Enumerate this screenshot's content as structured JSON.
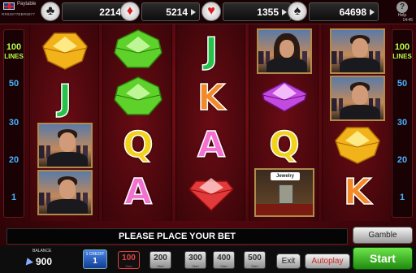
{
  "header": {
    "paytable_label": "Paytable",
    "code": "RR92877BBR9877",
    "help_label": "Help",
    "clock": "14:45"
  },
  "jackpots": [
    {
      "suit": "club-icon",
      "glyph": "♣",
      "value": "2214",
      "color": "#222222"
    },
    {
      "suit": "diamond-icon",
      "glyph": "♦",
      "value": "5214",
      "color": "#d81e1e"
    },
    {
      "suit": "heart-icon",
      "glyph": "♥",
      "value": "1355",
      "color": "#d81e1e"
    },
    {
      "suit": "spade-icon",
      "glyph": "♠",
      "value": "64698",
      "color": "#222222"
    }
  ],
  "lines": {
    "count": "100",
    "label": "LINES",
    "markers": [
      "50",
      "30",
      "20",
      "1"
    ]
  },
  "reels": [
    [
      {
        "type": "yellow-gem-icon"
      },
      {
        "type": "letter",
        "text": "J",
        "color": "#27c24a"
      },
      {
        "type": "businessman-portrait"
      },
      {
        "type": "businessman-portrait"
      }
    ],
    [
      {
        "type": "green-gem-icon"
      },
      {
        "type": "green-gem-icon"
      },
      {
        "type": "letter",
        "text": "Q",
        "color": "#f2d21a"
      },
      {
        "type": "letter",
        "text": "A",
        "color": "#f36fd0"
      }
    ],
    [
      {
        "type": "letter",
        "text": "J",
        "color": "#27c24a"
      },
      {
        "type": "letter",
        "text": "K",
        "color": "#f28a2a"
      },
      {
        "type": "letter",
        "text": "A",
        "color": "#f36fd0"
      },
      {
        "type": "red-gem-icon"
      }
    ],
    [
      {
        "type": "woman-portrait"
      },
      {
        "type": "purple-gem-icon"
      },
      {
        "type": "letter",
        "text": "Q",
        "color": "#f2d21a"
      },
      {
        "type": "jewelry-store-icon",
        "sign": "Jewelry"
      }
    ],
    [
      {
        "type": "businessman-portrait"
      },
      {
        "type": "businessman-portrait"
      },
      {
        "type": "yellow-gem-icon"
      },
      {
        "type": "letter",
        "text": "K",
        "color": "#f28a2a"
      }
    ]
  ],
  "message": "PLEASE PLACE YOUR BET",
  "footer": {
    "balance_label": "BALANCE",
    "balance_value": "900",
    "credit_label": "1 CREDIT",
    "credit_value": "1",
    "bets": [
      {
        "value": "100",
        "sub": "Start",
        "active": true
      },
      {
        "value": "200",
        "sub": "Start",
        "active": false
      },
      {
        "value": "300",
        "sub": "Start",
        "active": false
      },
      {
        "value": "400",
        "sub": "Start",
        "active": false
      },
      {
        "value": "500",
        "sub": "Start",
        "active": false
      }
    ],
    "exit_label": "Exit",
    "autoplay_label": "Autoplay",
    "gamble_label": "Gamble",
    "start_label": "Start"
  }
}
